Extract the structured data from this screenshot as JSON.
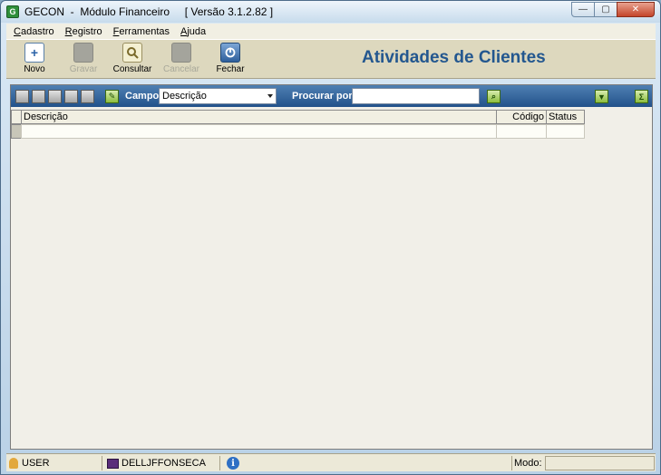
{
  "window": {
    "title": "GECON  -  Módulo Financeiro     [ Versão 3.1.2.82 ]",
    "app_icon_letter": "G",
    "controls": {
      "minimize": "—",
      "maximize": "▢",
      "close": "✕"
    }
  },
  "menubar": {
    "items": [
      {
        "label": "Cadastro",
        "accel": "C",
        "rest": "adastro"
      },
      {
        "label": "Registro",
        "accel": "R",
        "rest": "egistro"
      },
      {
        "label": "Ferramentas",
        "accel": "F",
        "rest": "erramentas"
      },
      {
        "label": "Ajuda",
        "accel": "A",
        "rest": "juda"
      }
    ]
  },
  "toolbar": {
    "novo_label": "Novo",
    "gravar_label": "Gravar",
    "consultar_label": "Consultar",
    "cancelar_label": "Cancelar",
    "fechar_label": "Fechar",
    "novo_icon": "+",
    "page_title": "Atividades de Clientes"
  },
  "filter": {
    "campo_label": "Campo",
    "campo_value": "Descrição",
    "procurar_label": "Procurar por",
    "search_value": "",
    "edit_icon_glyph": "✎",
    "search_icon_glyph": "⌕",
    "filter_icon_glyph": "▼",
    "sum_icon_glyph": "Σ"
  },
  "grid": {
    "columns": [
      {
        "label": "Descrição"
      },
      {
        "label": "Código"
      },
      {
        "label": "Status"
      }
    ]
  },
  "statusbar": {
    "user": "USER",
    "machine": "DELLJFFONSECA",
    "info_glyph": "i",
    "modo_label": "Modo:"
  }
}
